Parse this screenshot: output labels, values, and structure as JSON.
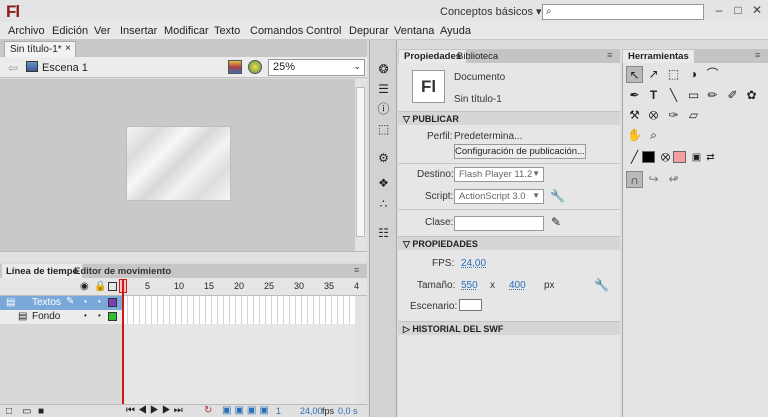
{
  "app": {
    "logo": "Fl",
    "workspace": "Conceptos básicos",
    "workspace_arrow": "▾"
  },
  "window_controls": {
    "minimize": "–",
    "maximize": "□",
    "close": "✕"
  },
  "menu": [
    "Archivo",
    "Edición",
    "Ver",
    "Insertar",
    "Modificar",
    "Texto",
    "Comandos",
    "Control",
    "Depurar",
    "Ventana",
    "Ayuda"
  ],
  "document": {
    "tab": "Sin título-1*",
    "close": "×",
    "scene": "Escena 1",
    "zoom": "25%"
  },
  "timeline": {
    "tabs": [
      "Línea de tiempo",
      "Editor de movimiento"
    ],
    "frame_numbers": [
      "5",
      "10",
      "15",
      "20",
      "25",
      "30",
      "35",
      "4"
    ],
    "layers": [
      {
        "name": "Textos",
        "selected": true,
        "color": "#7b3fb3"
      },
      {
        "name": "Fondo",
        "selected": false,
        "color": "#2fbf2f"
      }
    ],
    "footer": {
      "frame": "1",
      "fps": "24,00",
      "fps_unit": "fps",
      "time": "0,0 s"
    }
  },
  "properties": {
    "tabs": [
      "Propiedades",
      "Biblioteca"
    ],
    "doc_icon": "Fl",
    "doc_type": "Documento",
    "doc_name": "Sin título-1",
    "publish_header": "PUBLICAR",
    "perfil_label": "Perfil:",
    "perfil_value": "Predetermina...",
    "config_button": "Configuración de publicación...",
    "destino_label": "Destino:",
    "destino_value": "Flash Player 11.2",
    "script_label": "Script:",
    "script_value": "ActionScript 3.0",
    "clase_label": "Clase:",
    "props_header": "PROPIEDADES",
    "fps_label": "FPS:",
    "fps_value": "24,00",
    "size_label": "Tamaño:",
    "width": "550",
    "x": "x",
    "height": "400",
    "unit": "px",
    "stage_label": "Escenario:",
    "swf_header": "HISTORIAL DEL SWF"
  },
  "tools": {
    "tab": "Herramientas"
  }
}
